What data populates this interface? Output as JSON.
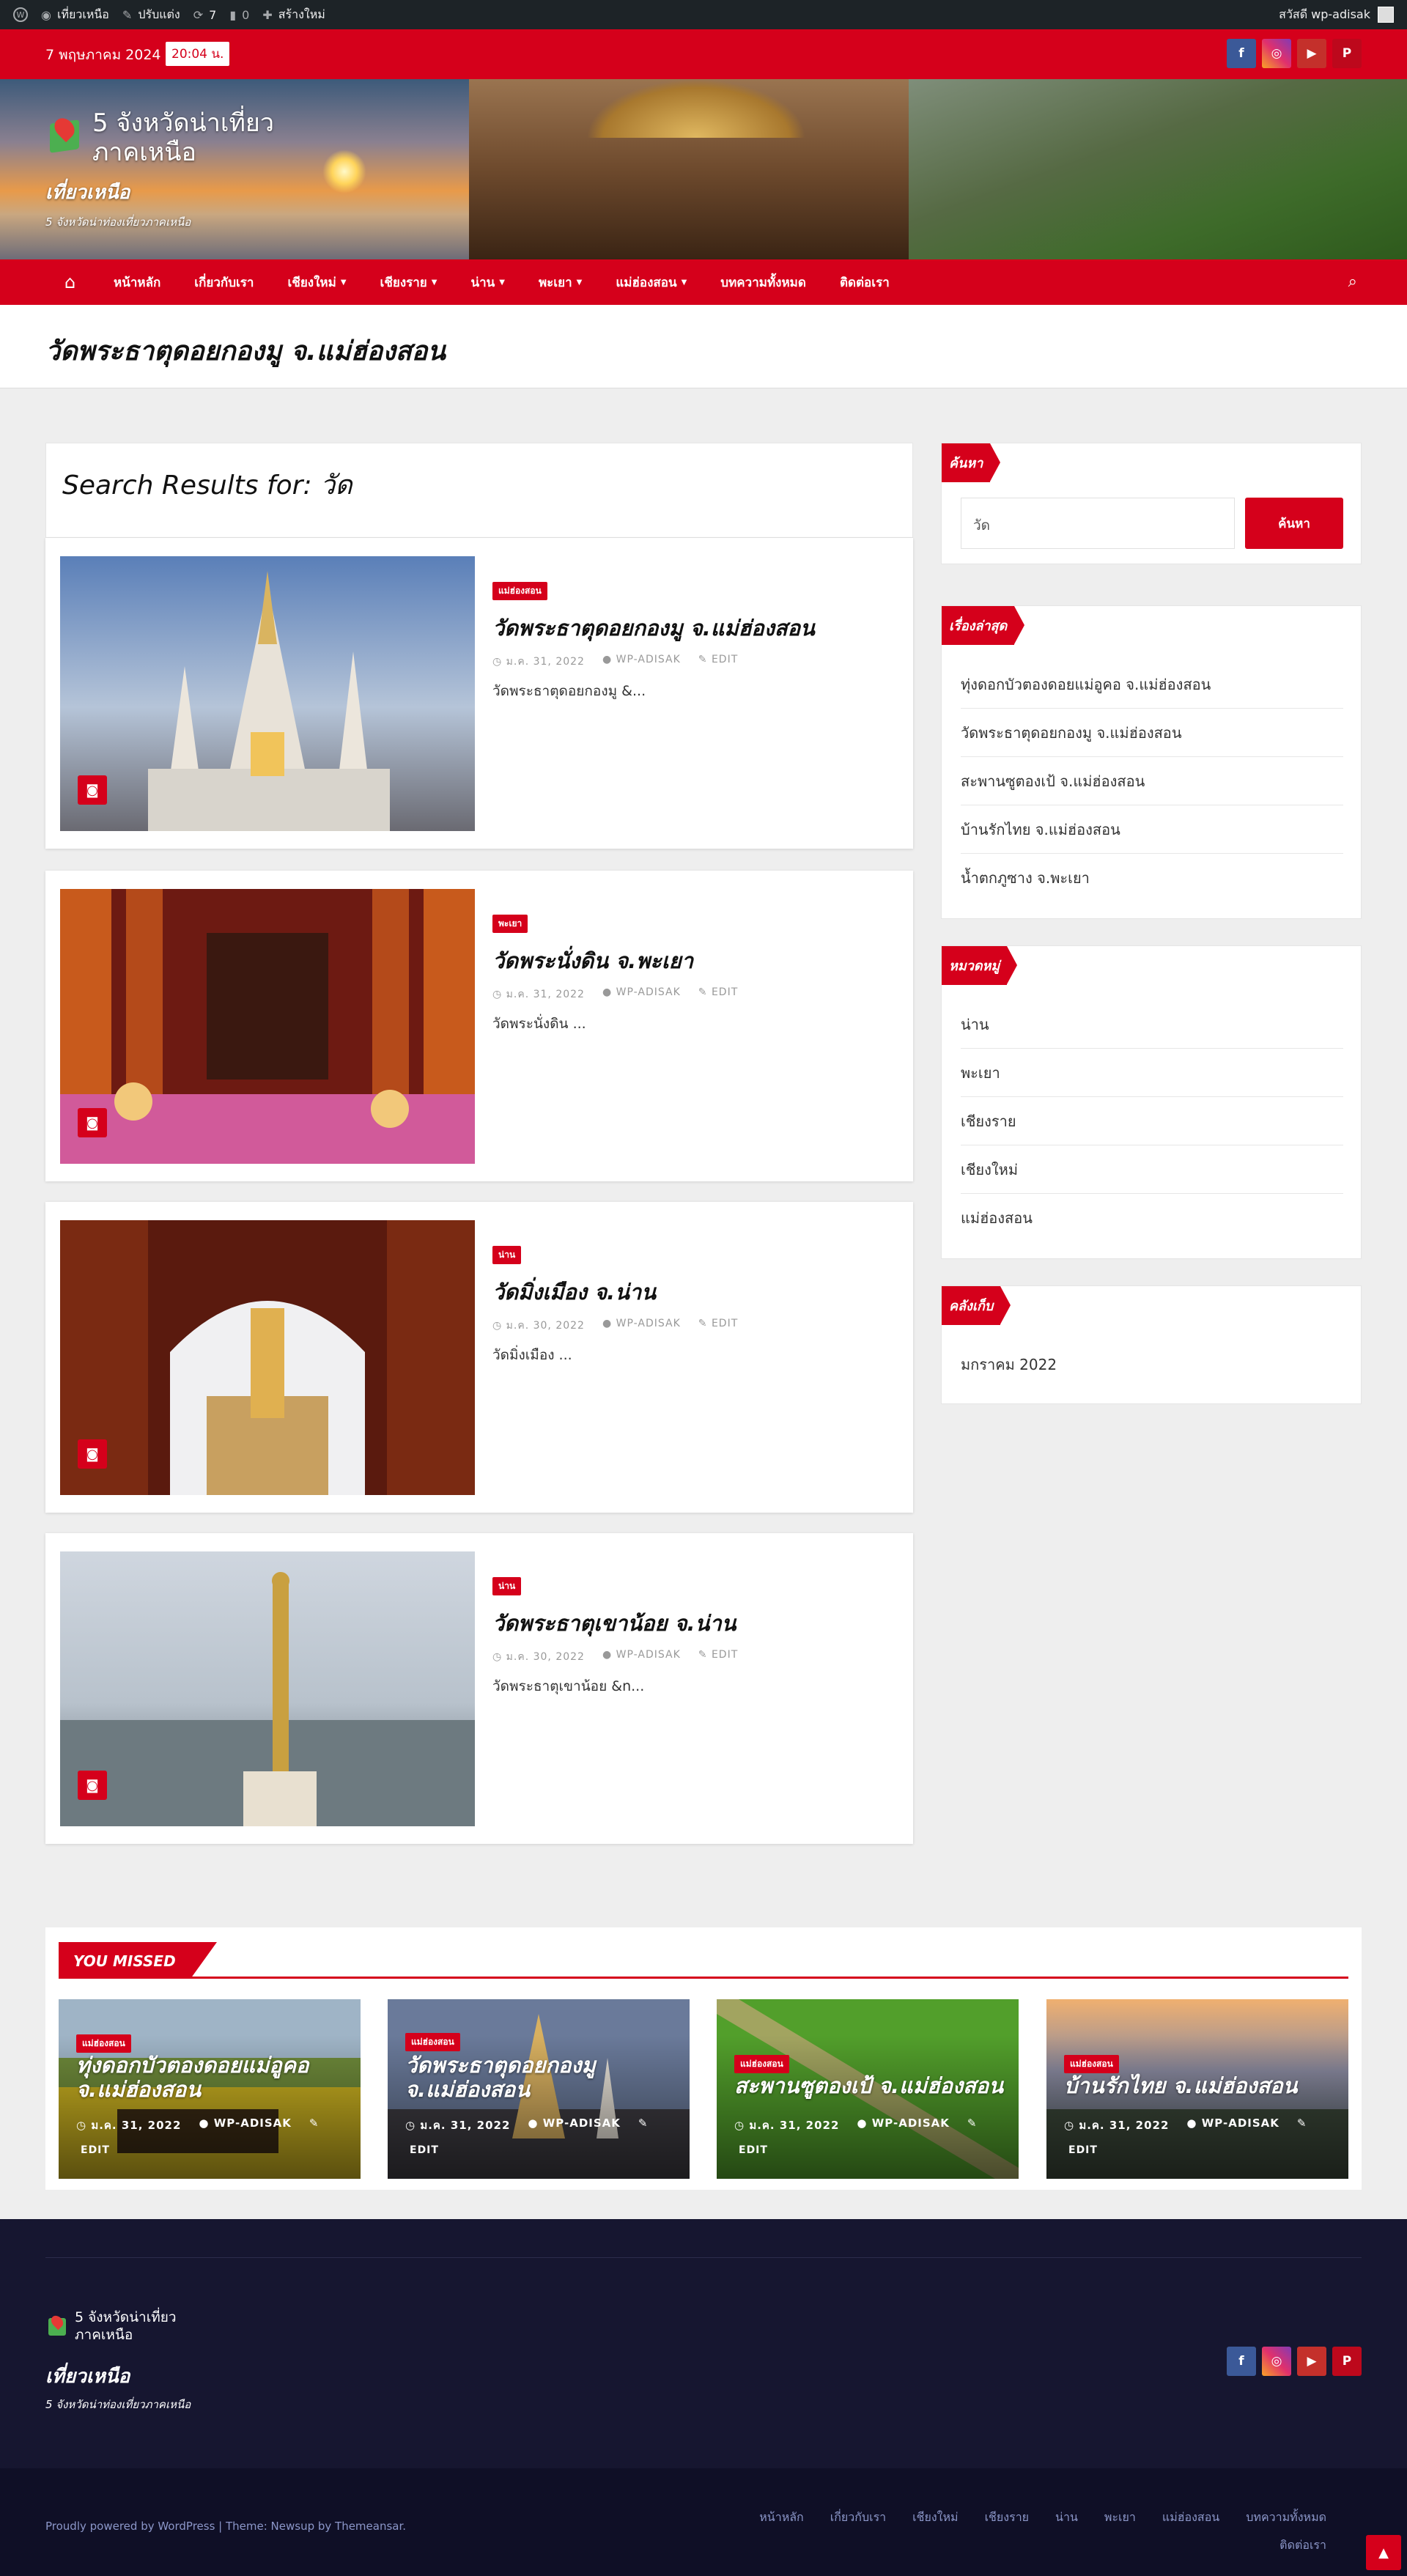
{
  "adminbar": {
    "site": "เที่ยวเหนือ",
    "customize": "ปรับแต่ง",
    "updates": "7",
    "comments": "0",
    "new": "สร้างใหม่",
    "howdy": "สวัสดี wp-adisak"
  },
  "topbar": {
    "date": "7 พฤษภาคม 2024",
    "time": "20:04 น."
  },
  "social": [
    "facebook-icon",
    "instagram-icon",
    "youtube-icon",
    "pinterest-icon"
  ],
  "brand": {
    "name_line1": "5 จังหวัดน่าเที่ยว",
    "name_line2": "ภาคเหนือ",
    "tagline": "เที่ยวเหนือ",
    "description": "5 จังหวัดน่าท่องเที่ยวภาคเหนือ"
  },
  "nav": {
    "items": [
      {
        "label": "หน้าหลัก",
        "dropdown": false
      },
      {
        "label": "เกี่ยวกับเรา",
        "dropdown": false
      },
      {
        "label": "เชียงใหม่",
        "dropdown": true
      },
      {
        "label": "เชียงราย",
        "dropdown": true
      },
      {
        "label": "น่าน",
        "dropdown": true
      },
      {
        "label": "พะเยา",
        "dropdown": true
      },
      {
        "label": "แม่ฮ่องสอน",
        "dropdown": true
      },
      {
        "label": "บทความทั้งหมด",
        "dropdown": false
      },
      {
        "label": "ติดต่อเรา",
        "dropdown": false
      }
    ]
  },
  "page_title": "วัดพระธาตุดอยกองมู จ.แม่ฮ่องสอน",
  "search": {
    "heading": "Search Results for: วัด"
  },
  "posts": [
    {
      "category": "แม่ฮ่องสอน",
      "title": "วัดพระธาตุดอยกองมู จ.แม่ฮ่องสอน",
      "date": "ม.ค. 31, 2022",
      "author": "WP-ADISAK",
      "edit": "EDIT",
      "excerpt": "วัดพระธาตุดอยกองมู &..."
    },
    {
      "category": "พะเยา",
      "title": "วัดพระนั่งดิน จ.พะเยา",
      "date": "ม.ค. 31, 2022",
      "author": "WP-ADISAK",
      "edit": "EDIT",
      "excerpt": "วัดพระนั่งดิน  ..."
    },
    {
      "category": "น่าน",
      "title": "วัดมิ่งเมือง จ.น่าน",
      "date": "ม.ค. 30, 2022",
      "author": "WP-ADISAK",
      "edit": "EDIT",
      "excerpt": "วัดมิ่งเมือง   ..."
    },
    {
      "category": "น่าน",
      "title": "วัดพระธาตุเขาน้อย จ.น่าน",
      "date": "ม.ค. 30, 2022",
      "author": "WP-ADISAK",
      "edit": "EDIT",
      "excerpt": "วัดพระธาตุเขาน้อย &n..."
    }
  ],
  "sidebar": {
    "search_title": "ค้นหา",
    "search_value": "วัด",
    "search_button": "ค้นหา",
    "recent_title": "เรื่องล่าสุด",
    "recent": [
      "ทุ่งดอกบัวตองดอยแม่อูคอ จ.แม่ฮ่องสอน",
      "วัดพระธาตุดอยกองมู จ.แม่ฮ่องสอน",
      "สะพานซูตองเป้ จ.แม่ฮ่องสอน",
      "บ้านรักไทย จ.แม่ฮ่องสอน",
      "น้ำตกภูซาง จ.พะเยา"
    ],
    "cat_title": "หมวดหมู่",
    "categories": [
      "น่าน",
      "พะเยา",
      "เชียงราย",
      "เชียงใหม่",
      "แม่ฮ่องสอน"
    ],
    "archive_title": "คลังเก็บ",
    "archives": [
      "มกราคม 2022"
    ]
  },
  "missed": {
    "title": "YOU MISSED",
    "items": [
      {
        "category": "แม่ฮ่องสอน",
        "title": "ทุ่งดอกบัวตองดอยแม่อูคอ จ.แม่ฮ่องสอน",
        "date": "ม.ค. 31, 2022",
        "author": "WP-ADISAK",
        "edit": "EDIT"
      },
      {
        "category": "แม่ฮ่องสอน",
        "title": "วัดพระธาตุดอยกองมู จ.แม่ฮ่องสอน",
        "date": "ม.ค. 31, 2022",
        "author": "WP-ADISAK",
        "edit": "EDIT"
      },
      {
        "category": "แม่ฮ่องสอน",
        "title": "สะพานซูตองเป้ จ.แม่ฮ่องสอน",
        "date": "ม.ค. 31, 2022",
        "author": "WP-ADISAK",
        "edit": "EDIT"
      },
      {
        "category": "แม่ฮ่องสอน",
        "title": "บ้านรักไทย จ.แม่ฮ่องสอน",
        "date": "ม.ค. 31, 2022",
        "author": "WP-ADISAK",
        "edit": "EDIT"
      }
    ]
  },
  "footer": {
    "copyright": "Proudly powered by WordPress | Theme: Newsup by Themeansar.",
    "links": [
      "หน้าหลัก",
      "เกี่ยวกับเรา",
      "เชียงใหม่",
      "เชียงราย",
      "น่าน",
      "พะเยา",
      "แม่ฮ่องสอน",
      "บทความทั้งหมด",
      "ติดต่อเรา"
    ]
  },
  "colors": {
    "accent": "#d5001b",
    "footer_bg": "#161630"
  }
}
